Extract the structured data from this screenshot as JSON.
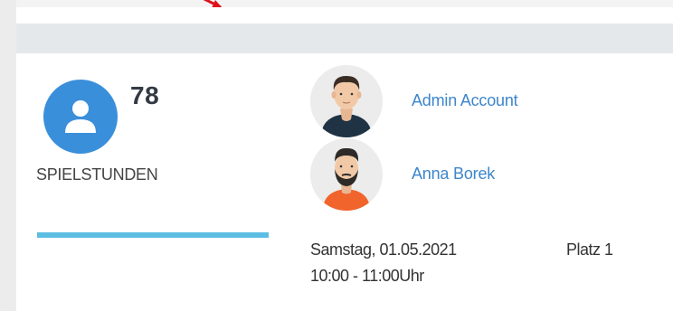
{
  "stats": {
    "value": "78",
    "label": "SPIELSTUNDEN",
    "progress_fraction": 1.0,
    "icon": "user-icon",
    "icon_color": "#3a8fdb",
    "progress_color": "#5cbde3"
  },
  "players": [
    {
      "name": "Admin Account",
      "avatar": "male-avatar-dark-shirt"
    },
    {
      "name": "Anna Borek",
      "avatar": "male-avatar-beard-orange-shirt"
    }
  ],
  "booking": {
    "date": "Samstag, 01.05.2021",
    "time": "10:00 - 11:00Uhr",
    "court": "Platz 1"
  },
  "colors": {
    "accent": "#3a8fdb",
    "link": "#3d86cc",
    "header": "#e5e8eb",
    "annotation": "#e0101a"
  }
}
